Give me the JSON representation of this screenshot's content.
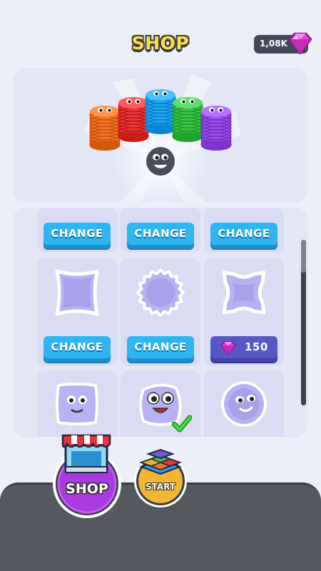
{
  "header": {
    "title": "SHOP",
    "gem_count": "1,08K",
    "gem_icon": "pink-gem-icon"
  },
  "preview": {
    "stack_colors": [
      "#f0762a",
      "#e63b3b",
      "#27a4f0",
      "#3fc14a",
      "#9a52e8"
    ],
    "character": "gray-blob-face"
  },
  "grid": {
    "row1": [
      {
        "button": "CHANGE"
      },
      {
        "button": "CHANGE"
      },
      {
        "button": "CHANGE"
      }
    ],
    "row2": [
      {
        "shape": "wavy-square-plate",
        "button": "CHANGE"
      },
      {
        "shape": "gear-round-plate",
        "button": "CHANGE"
      },
      {
        "shape": "curved-square-plate",
        "price": "150",
        "price_icon": "pink-gem-icon"
      }
    ],
    "row3": [
      {
        "skin": "square-face"
      },
      {
        "skin": "blob-face",
        "selected": true,
        "selected_icon": "checkmark-icon"
      },
      {
        "skin": "round-face"
      }
    ]
  },
  "bottom_nav": {
    "shop_label": "SHOP",
    "start_label": "START",
    "shop_icon": "storefront-icon",
    "start_icon": "color-stack-icon"
  }
}
